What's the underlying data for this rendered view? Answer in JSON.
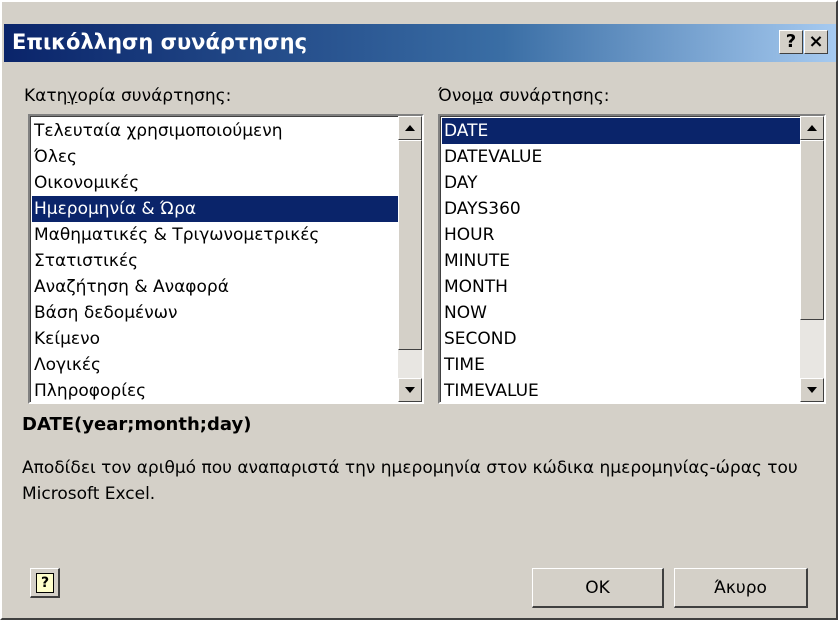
{
  "window": {
    "title": "Επικόλληση συνάρτησης",
    "help_glyph": "?",
    "close_glyph": "×"
  },
  "category": {
    "label_pre": "Κατη",
    "label_accel": "γ",
    "label_post": "ορία συνάρτησης:",
    "items": [
      "Τελευταία χρησιμοποιούμενη",
      "Όλες",
      "Οικονομικές",
      "Ημερομηνία & Ώρα",
      "Μαθηματικές & Τριγωνομετρικές",
      "Στατιστικές",
      "Αναζήτηση & Αναφορά",
      "Βάση δεδομένων",
      "Κείμενο",
      "Λογικές",
      "Πληροφορίες"
    ],
    "selected_index": 3
  },
  "function_name": {
    "label_pre": "Όνο",
    "label_accel": "μ",
    "label_post": "α συνάρτησης:",
    "items": [
      "DATE",
      "DATEVALUE",
      "DAY",
      "DAYS360",
      "HOUR",
      "MINUTE",
      "MONTH",
      "NOW",
      "SECOND",
      "TIME",
      "TIMEVALUE"
    ],
    "selected_index": 0
  },
  "syntax": "DATE(year;month;day)",
  "description": "Αποδίδει τον αριθμό που αναπαριστά την ημερομηνία στον κώδικα ημερομηνίας-ώρας του Microsoft Excel.",
  "buttons": {
    "ok_label": "OK",
    "cancel_label": "Άκυρο",
    "help_glyph": "?"
  },
  "colors": {
    "selection": "#0a246a",
    "face": "#d4d0c8"
  }
}
